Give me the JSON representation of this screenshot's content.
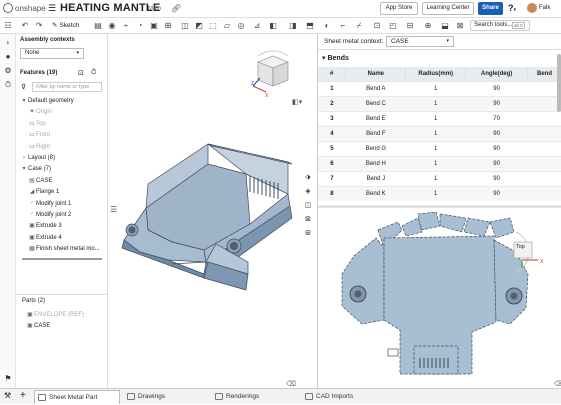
{
  "topbar": {
    "logo_text": "onshape",
    "doc_title": "HEATING MANTLE",
    "branch": "Main",
    "app_store": "App Store",
    "learning_center": "Learning Center",
    "share": "Share",
    "user_name": "Falk"
  },
  "toolbar": {
    "sketch_label": "Sketch",
    "search_placeholder": "Search tools...",
    "search_shortcut": "alt C"
  },
  "features_panel": {
    "assembly_contexts_label": "Assembly contexts",
    "context_value": "None",
    "features_label": "Features (19)",
    "filter_placeholder": "Filter by name or type",
    "tree": [
      {
        "label": "Default geometry",
        "indent": 0,
        "icon": "▾",
        "dim": false
      },
      {
        "label": "Origin",
        "indent": 1,
        "icon": "✦",
        "dim": true
      },
      {
        "label": "Top",
        "indent": 1,
        "icon": "▭",
        "dim": true
      },
      {
        "label": "Front",
        "indent": 1,
        "icon": "▭",
        "dim": true
      },
      {
        "label": "Right",
        "indent": 1,
        "icon": "▭",
        "dim": true
      },
      {
        "label": "Layout (8)",
        "indent": 0,
        "icon": "›",
        "dim": false
      },
      {
        "label": "Case (7)",
        "indent": 0,
        "icon": "▾",
        "dim": false
      },
      {
        "label": "CASE",
        "indent": 1,
        "icon": "▤",
        "dim": false
      },
      {
        "label": "Flange 1",
        "indent": 1,
        "icon": "◢",
        "dim": false
      },
      {
        "label": "Modify joint 1",
        "indent": 1,
        "icon": "◜",
        "dim": false
      },
      {
        "label": "Modify joint 2",
        "indent": 1,
        "icon": "◜",
        "dim": false
      },
      {
        "label": "Extrude 3",
        "indent": 1,
        "icon": "▣",
        "dim": false
      },
      {
        "label": "Extrude 4",
        "indent": 1,
        "icon": "▣",
        "dim": false
      },
      {
        "label": "Finish sheet metal mo...",
        "indent": 1,
        "icon": "▦",
        "dim": false
      }
    ],
    "parts_label": "Parts (2)",
    "parts": [
      {
        "label": "ENVELOPE (REF)",
        "dim": true
      },
      {
        "label": "CASE",
        "dim": false
      }
    ]
  },
  "right_panel": {
    "context_label": "Sheet metal context:",
    "context_value": "CASE",
    "bends_label": "Bends",
    "columns": [
      "#",
      "Name",
      "Radius(mm)",
      "Angle(deg)",
      "Bend"
    ],
    "rows": [
      [
        "1",
        "Bend A",
        "1",
        "90"
      ],
      [
        "2",
        "Bend C",
        "1",
        "90"
      ],
      [
        "3",
        "Bend E",
        "1",
        "70"
      ],
      [
        "4",
        "Bend F",
        "1",
        "90"
      ],
      [
        "5",
        "Bend G",
        "1",
        "90"
      ],
      [
        "6",
        "Bend H",
        "1",
        "90"
      ],
      [
        "7",
        "Bend J",
        "1",
        "90"
      ],
      [
        "8",
        "Bend K",
        "1",
        "90"
      ]
    ],
    "view_cube_label": "Top"
  },
  "bottom_tabs": {
    "tabs": [
      "Sheet Metal Part",
      "Drawings",
      "Renderings",
      "CAD Imports"
    ]
  }
}
